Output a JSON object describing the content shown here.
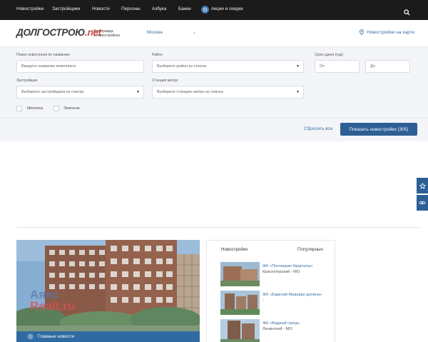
{
  "topnav": {
    "items": [
      "Новостройки",
      "Застройщики",
      "Новости",
      "Персоны",
      "Азбука",
      "Банки",
      "Акции и скидки"
    ]
  },
  "header": {
    "logo_main": "ДОЛГОСТРОЮ",
    "logo_net": ".net",
    "tagline": "Вся правда\nо новостройках",
    "city": "Москва",
    "map_link": "Новостройки на карте"
  },
  "filters": {
    "search_label": "Поиск новостроек по названию",
    "search_placeholder": "Введите название комплекса",
    "district_label": "Район",
    "district_value": "Выберите район из списка",
    "deadline_label": "Срок сдачи (год)",
    "from_placeholder": "От",
    "to_placeholder": "До",
    "developer_label": "Застройщик",
    "developer_value": "Выберите застройщика из списка",
    "metro_label": "Станция метро",
    "metro_value": "Выберите станцию метро из списка",
    "mortgage_label": "Ипотека",
    "elite_label": "Элитное",
    "reset_label": "Сбросить все",
    "show_button": "Показать новостройки (305)"
  },
  "news": {
    "number": "1",
    "title": "Главные новости",
    "watermark_line1": "Аякс",
    "watermark_line2": "Realt.ru"
  },
  "listing": {
    "tab_new": "Новостройки",
    "tab_popular": "Популярные",
    "items": [
      {
        "name": "ЖК «Пятницкие Кварталы»",
        "location": "Красногорский - МО"
      },
      {
        "name": "ЖК «Барклай Медовая долина»",
        "location": "-"
      },
      {
        "name": "ЖК «Видный город»",
        "location": "Ленинский - МО"
      }
    ]
  },
  "colors": {
    "accent": "#2d5f95",
    "link": "#3d6fa5",
    "topbar": "#1b1b1b",
    "logo_red": "#d64a4a"
  }
}
